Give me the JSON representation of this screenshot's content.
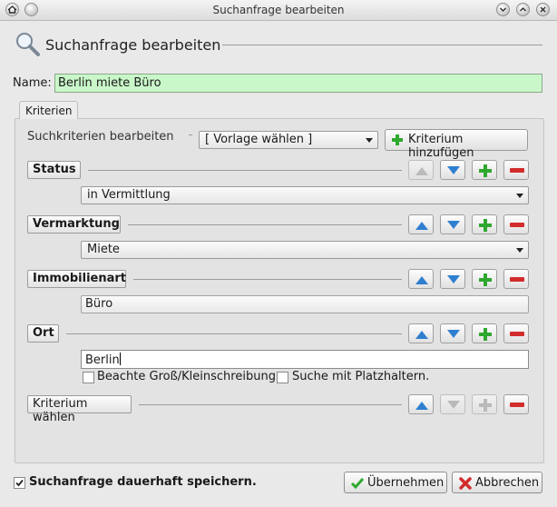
{
  "window": {
    "title": "Suchanfrage bearbeiten"
  },
  "heading": {
    "title": "Suchanfrage bearbeiten"
  },
  "name": {
    "label": "Name:",
    "value": "Berlin miete Büro"
  },
  "tab": {
    "label": "Kriterien"
  },
  "toolbar": {
    "label": "Suchkriterien bearbeiten",
    "template_select": "[ Vorlage wählen ]",
    "add_button": "Kriterium hinzufügen"
  },
  "criteria": [
    {
      "label": "Status",
      "value": "in Vermittlung"
    },
    {
      "label": "Vermarktung",
      "value": "Miete"
    },
    {
      "label": "Immobilienart",
      "value": "Büro"
    },
    {
      "label": "Ort",
      "value": "Berlin",
      "case_sensitive": "Beachte Groß/Kleinschreibung.",
      "wildcards": "Suche mit Platzhaltern."
    }
  ],
  "new_criterion": {
    "label": "Kriterium wählen"
  },
  "footer": {
    "save_checkbox": "Suchanfrage dauerhaft speichern.",
    "apply_button": "Übernehmen",
    "cancel_button": "Abbrechen"
  },
  "colors": {
    "name_field_bg": "#c9f7c9",
    "up_arrow": "#2f7fd0",
    "plus": "#2fa82f",
    "minus": "#d22c2c"
  }
}
